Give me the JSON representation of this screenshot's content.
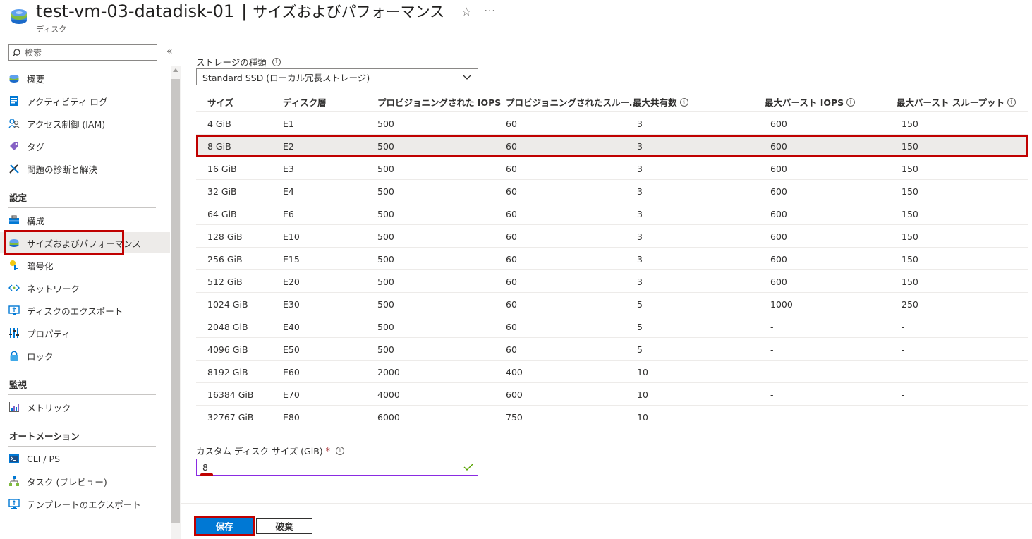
{
  "header": {
    "title": "test-vm-03-datadisk-01",
    "separator": "|",
    "section": "サイズおよびパフォーマンス",
    "subtitle": "ディスク",
    "star_icon": "☆",
    "more_icon": "···"
  },
  "sidebar": {
    "search_placeholder": "検索",
    "collapse_icon": "«",
    "items_top": [
      {
        "label": "概要",
        "icon": "disk-icon"
      },
      {
        "label": "アクティビティ ログ",
        "icon": "activity-log-icon"
      },
      {
        "label": "アクセス制御 (IAM)",
        "icon": "iam-icon"
      },
      {
        "label": "タグ",
        "icon": "tag-icon"
      },
      {
        "label": "問題の診断と解決",
        "icon": "wrench-icon"
      }
    ],
    "section_settings": "設定",
    "items_settings": [
      {
        "label": "構成",
        "icon": "toolbox-icon"
      },
      {
        "label": "サイズおよびパフォーマンス",
        "icon": "disk-icon",
        "selected": true
      },
      {
        "label": "暗号化",
        "icon": "key-icon"
      },
      {
        "label": "ネットワーク",
        "icon": "network-icon"
      },
      {
        "label": "ディスクのエクスポート",
        "icon": "export-icon"
      },
      {
        "label": "プロパティ",
        "icon": "properties-icon"
      },
      {
        "label": "ロック",
        "icon": "lock-icon"
      }
    ],
    "section_monitoring": "監視",
    "items_monitoring": [
      {
        "label": "メトリック",
        "icon": "metrics-icon"
      }
    ],
    "section_automation": "オートメーション",
    "items_automation": [
      {
        "label": "CLI / PS",
        "icon": "cli-icon"
      },
      {
        "label": "タスク (プレビュー)",
        "icon": "tasks-icon"
      },
      {
        "label": "テンプレートのエクスポート",
        "icon": "export-template-icon"
      }
    ]
  },
  "main": {
    "storage_label": "ストレージの種類",
    "storage_value": "Standard SSD (ローカル冗長ストレージ)",
    "table": {
      "headers": [
        "サイズ",
        "ディスク層",
        "プロビジョニングされた IOPS",
        "プロビジョニングされたスルー…",
        "最大共有数",
        "最大バースト IOPS",
        "最大バースト スループット"
      ],
      "selected_index": 1,
      "rows": [
        [
          "4 GiB",
          "E1",
          "500",
          "60",
          "3",
          "600",
          "150"
        ],
        [
          "8 GiB",
          "E2",
          "500",
          "60",
          "3",
          "600",
          "150"
        ],
        [
          "16 GiB",
          "E3",
          "500",
          "60",
          "3",
          "600",
          "150"
        ],
        [
          "32 GiB",
          "E4",
          "500",
          "60",
          "3",
          "600",
          "150"
        ],
        [
          "64 GiB",
          "E6",
          "500",
          "60",
          "3",
          "600",
          "150"
        ],
        [
          "128 GiB",
          "E10",
          "500",
          "60",
          "3",
          "600",
          "150"
        ],
        [
          "256 GiB",
          "E15",
          "500",
          "60",
          "3",
          "600",
          "150"
        ],
        [
          "512 GiB",
          "E20",
          "500",
          "60",
          "3",
          "600",
          "150"
        ],
        [
          "1024 GiB",
          "E30",
          "500",
          "60",
          "5",
          "1000",
          "250"
        ],
        [
          "2048 GiB",
          "E40",
          "500",
          "60",
          "5",
          "-",
          "-"
        ],
        [
          "4096 GiB",
          "E50",
          "500",
          "60",
          "5",
          "-",
          "-"
        ],
        [
          "8192 GiB",
          "E60",
          "2000",
          "400",
          "10",
          "-",
          "-"
        ],
        [
          "16384 GiB",
          "E70",
          "4000",
          "600",
          "10",
          "-",
          "-"
        ],
        [
          "32767 GiB",
          "E80",
          "6000",
          "750",
          "10",
          "-",
          "-"
        ]
      ]
    },
    "custom_size_label": "カスタム ディスク サイズ (GiB)",
    "required_mark": "*",
    "custom_size_value": "8",
    "save_label": "保存",
    "discard_label": "破棄"
  },
  "colors": {
    "accent": "#0078d4",
    "highlight": "#c00000",
    "selected_bg": "#edebe9"
  }
}
